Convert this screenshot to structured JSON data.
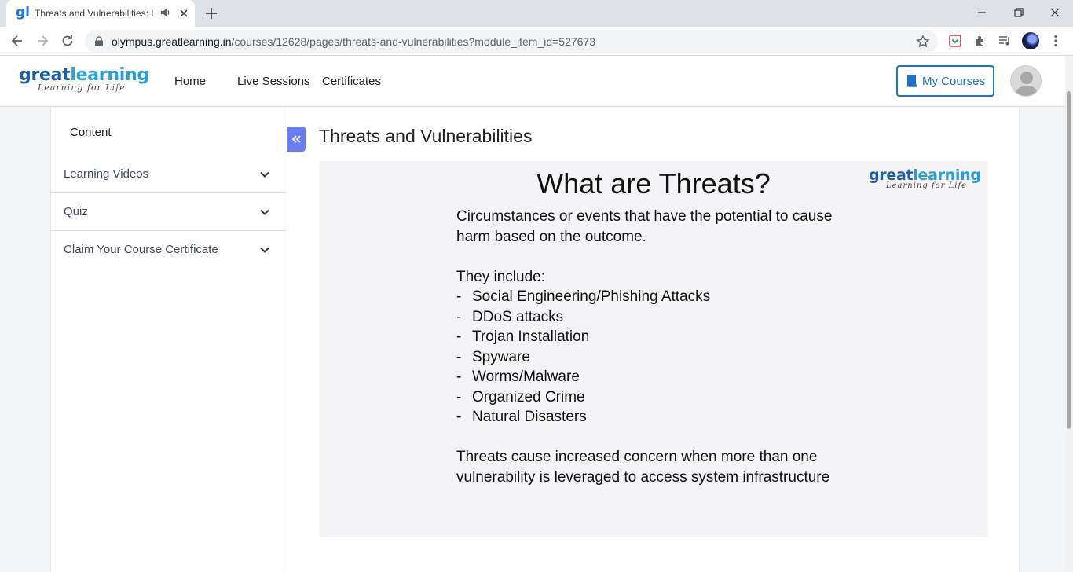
{
  "browser": {
    "tab_title": "Threats and Vulnerabilities: I",
    "tab_favicon": "gl",
    "url_domain": "olympus.greatlearning.in",
    "url_path": "/courses/12628/pages/threats-and-vulnerabilities?module_item_id=527673"
  },
  "header": {
    "logo_main_a": "great",
    "logo_main_b": "learning",
    "logo_sub": "Learning for Life",
    "nav": {
      "home": "Home",
      "live_sessions": "Live Sessions",
      "certificates": "Certificates"
    },
    "my_courses": "My Courses"
  },
  "sidebar": {
    "title": "Content",
    "items": [
      {
        "label": "Learning Videos"
      },
      {
        "label": "Quiz"
      },
      {
        "label": "Claim Your Course Certificate"
      }
    ]
  },
  "main": {
    "title": "Threats and Vulnerabilities",
    "slide": {
      "heading": "What are Threats?",
      "logo_main_a": "great",
      "logo_main_b": "learning",
      "logo_sub": "Learning for Life",
      "intro_line1": "Circumstances or events that have the potential to cause",
      "intro_line2": "harm based on the outcome.",
      "list_intro": "They include:",
      "bullets": [
        "Social Engineering/Phishing Attacks",
        "DDoS attacks",
        "Trojan Installation",
        "Spyware",
        "Worms/Malware",
        "Organized Crime",
        "Natural Disasters"
      ],
      "closing_line1": "Threats cause increased concern when more than one",
      "closing_line2": "vulnerability is leveraged to access  system infrastructure"
    }
  },
  "colors": {
    "accent": "#1a73c8",
    "collapse_button": "#6b7bf0",
    "logo_dark": "#1d5fa6",
    "logo_light": "#2a9fd8"
  }
}
